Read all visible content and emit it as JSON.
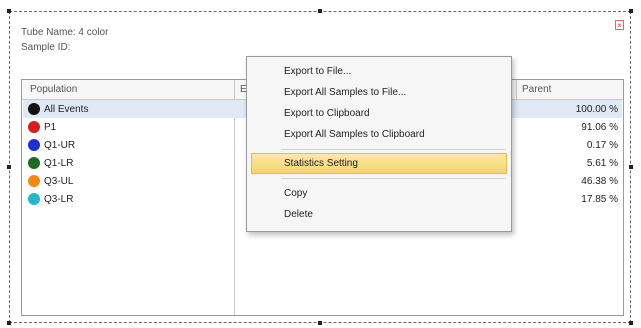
{
  "panel": {
    "tube_name": "Tube Name:  4 color",
    "sample_id": "Sample ID:",
    "close_glyph": "×"
  },
  "table": {
    "headers": {
      "population": "Population",
      "events": "Ev",
      "parent": "Parent"
    },
    "rows": [
      {
        "label": "All Events",
        "color": "#111111",
        "parent_pct": "100.00 %"
      },
      {
        "label": "P1",
        "color": "#d42020",
        "parent_pct": "91.06 %"
      },
      {
        "label": "Q1-UR",
        "color": "#1f2fd0",
        "parent_pct": "0.17 %"
      },
      {
        "label": "Q1-LR",
        "color": "#1c6b24",
        "parent_pct": "5.61 %"
      },
      {
        "label": "Q3-UL",
        "color": "#f08a12",
        "parent_pct": "46.38 %"
      },
      {
        "label": "Q3-LR",
        "color": "#22b8c8",
        "parent_pct": "17.85 %"
      }
    ],
    "selected_row": "All Events"
  },
  "context_menu": {
    "items": [
      "Export to File...",
      "Export All Samples to File...",
      "Export to Clipboard",
      "Export All Samples to Clipboard",
      "Statistics Setting",
      "Copy",
      "Delete"
    ],
    "highlighted_item": "Statistics Setting"
  }
}
